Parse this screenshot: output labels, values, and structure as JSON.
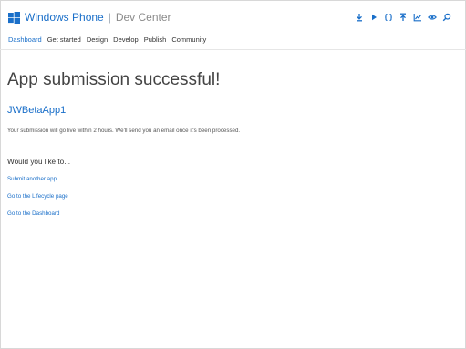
{
  "header": {
    "brand_name": "Windows Phone",
    "separator": "|",
    "brand_sub": "Dev Center",
    "tools": [
      "download-icon",
      "play-icon",
      "braces-icon",
      "upload-icon",
      "chart-icon",
      "eye-icon",
      "search-icon"
    ]
  },
  "nav": {
    "items": [
      {
        "label": "Dashboard",
        "active": true
      },
      {
        "label": "Get started",
        "active": false
      },
      {
        "label": "Design",
        "active": false
      },
      {
        "label": "Develop",
        "active": false
      },
      {
        "label": "Publish",
        "active": false
      },
      {
        "label": "Community",
        "active": false
      }
    ]
  },
  "main": {
    "title": "App submission successful!",
    "app_name": "JWBetaApp1",
    "message": "Your submission will go live within 2 hours. We'll send you an email once it's been processed.",
    "question": "Would you like to...",
    "links": [
      {
        "label": "Submit another app"
      },
      {
        "label": "Go to the Lifecycle page"
      },
      {
        "label": "Go to the Dashboard"
      }
    ]
  },
  "colors": {
    "accent": "#1a6fc9",
    "text": "#333333"
  }
}
